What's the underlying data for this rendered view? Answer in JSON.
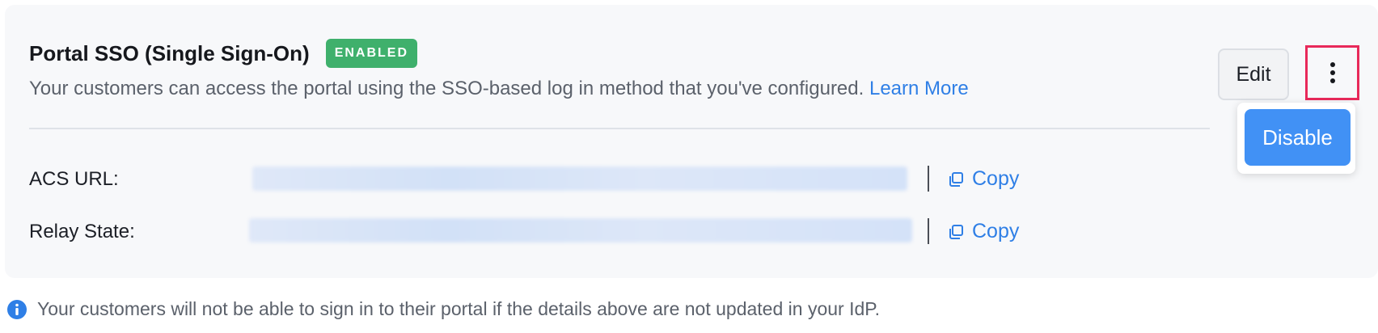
{
  "section": {
    "title": "Portal SSO (Single Sign-On)",
    "status_badge": "ENABLED",
    "description": "Your customers can access the portal using the SSO-based log in method that you've configured.",
    "learn_more_label": "Learn More"
  },
  "actions": {
    "edit_label": "Edit",
    "more_icon": "vertical-ellipsis-icon",
    "menu": {
      "disable_label": "Disable"
    }
  },
  "fields": [
    {
      "label": "ACS URL:",
      "copy_label": "Copy"
    },
    {
      "label": "Relay State:",
      "copy_label": "Copy"
    }
  ],
  "footer_note": "Your customers will not be able to sign in to their portal if the details above are not updated in your IdP.",
  "colors": {
    "badge_bg": "#3fb06c",
    "link": "#2f7fe6",
    "primary_button": "#4191f5",
    "highlight_border": "#e8295a"
  }
}
